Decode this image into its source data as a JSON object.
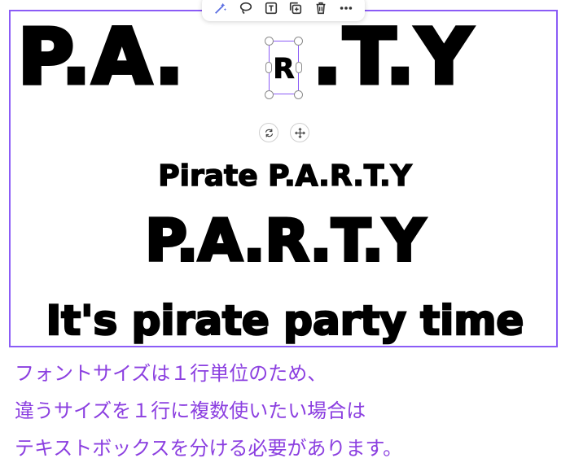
{
  "toolbar": {
    "icons": [
      "magic-write-icon",
      "lasso-icon",
      "text-box-icon",
      "duplicate-icon",
      "delete-icon",
      "more-icon"
    ]
  },
  "canvas": {
    "title_left": "P.A.",
    "title_selected_letter": "R",
    "title_right": ".T.Y",
    "line2": "Pirate P.A.R.T.Y",
    "line3": "P.A.R.T.Y",
    "line4": "It's pirate party time"
  },
  "note": {
    "line1": "フォントサイズは１行単位のため、",
    "line2": "違うサイズを１行に複数使いたい場合は",
    "line3": "テキストボックスを分ける必要があります。"
  },
  "colors": {
    "selection": "#8b5cf6",
    "note_text": "#8b3fe0",
    "text": "#000000"
  }
}
